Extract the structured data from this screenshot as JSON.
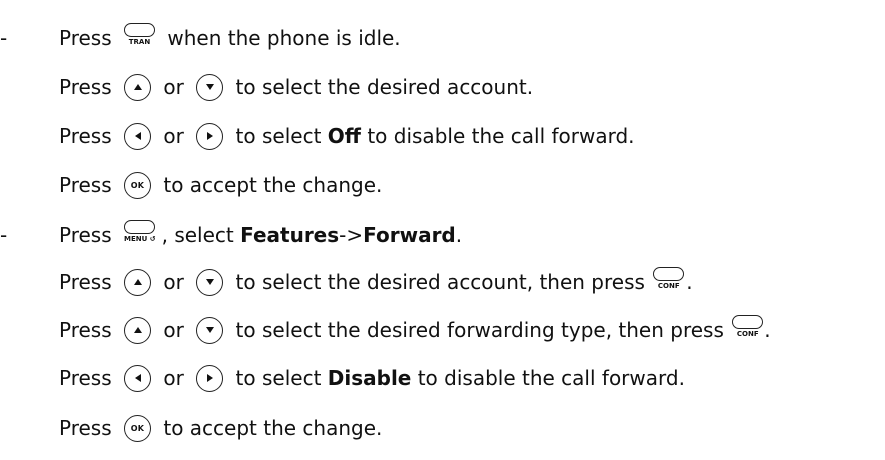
{
  "bullet": "-",
  "press": "Press ",
  "or": " or ",
  "keys": {
    "tran": "TRAN",
    "menu": "MENU",
    "conf": "CONF",
    "ok": "OK"
  },
  "menu_arrow_glyph": "↺",
  "icons": {
    "up": "up-arrow-icon",
    "down": "down-arrow-icon",
    "left": "left-arrow-icon",
    "right": "right-arrow-icon"
  },
  "section1": {
    "line1_text": " when the phone is idle.",
    "line2_text": " to select the desired account.",
    "line3_pre": " to select ",
    "line3_bold": "Off",
    "line3_post": " to disable the call forward.",
    "line4_text": " to accept the change."
  },
  "section2": {
    "line1_pre": ", select ",
    "line1_bold1": "Features",
    "line1_sep": "->",
    "line1_bold2": "Forward",
    "line1_post": ".",
    "line2_text": " to select the desired account, then press ",
    "line2_end": ".",
    "line3_text": " to select the desired forwarding type, then press ",
    "line3_end": ".",
    "line4_pre": " to select ",
    "line4_bold": "Disable",
    "line4_post": " to disable the call forward.",
    "line5_text": " to accept the change."
  }
}
